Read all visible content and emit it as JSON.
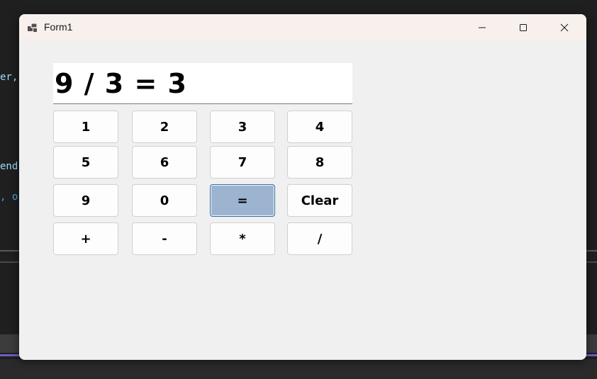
{
  "background": {
    "code_fragments": [
      "er,",
      "end",
      ", o"
    ]
  },
  "window": {
    "title": "Form1",
    "icon": "app-window-icon",
    "controls": {
      "minimize": "minimize-icon",
      "maximize": "maximize-icon",
      "close": "close-icon"
    }
  },
  "display": {
    "text": "9 / 3 = 3"
  },
  "keypad": {
    "k1": "1",
    "k2": "2",
    "k3": "3",
    "k4": "4",
    "k5": "5",
    "k6": "6",
    "k7": "7",
    "k8": "8",
    "k9": "9",
    "k0": "0",
    "equals": "=",
    "clear": "Clear",
    "plus": "+",
    "minus": "-",
    "multiply": "*",
    "divide": "/"
  },
  "colors": {
    "pressed_button": "#9cb4d0",
    "pressed_border": "#2b6aa8",
    "titlebar": "#f7f0ec",
    "window_bg": "#f0f0f0"
  }
}
